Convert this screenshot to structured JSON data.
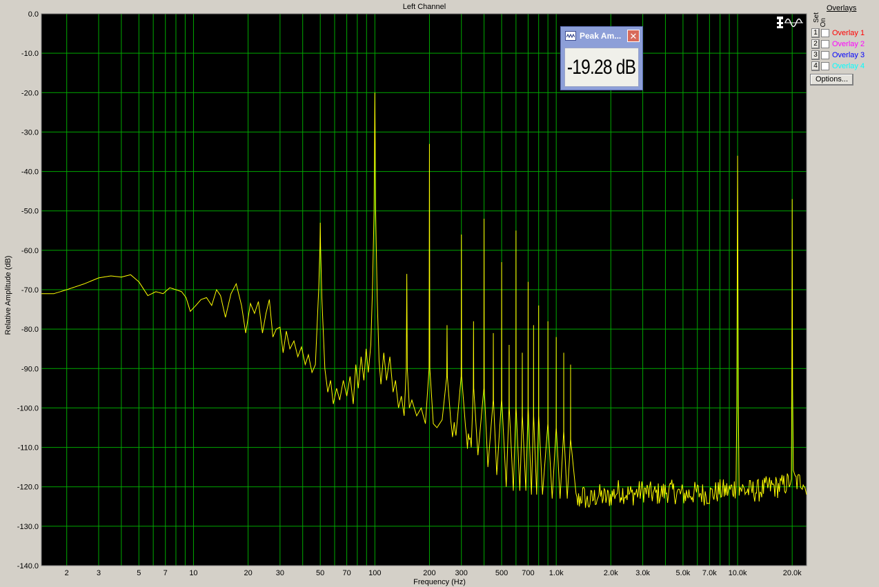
{
  "chart_data": {
    "type": "line",
    "title": "Left Channel",
    "xlabel": "Frequency (Hz)",
    "ylabel": "Relative Amplitude (dB)",
    "x_scale": "log",
    "xlim": [
      1.45,
      24000
    ],
    "ylim": [
      -140,
      0
    ],
    "grid": true,
    "y_ticks": [
      "0.0",
      "-10.0",
      "-20.0",
      "-30.0",
      "-40.0",
      "-50.0",
      "-60.0",
      "-70.0",
      "-80.0",
      "-90.0",
      "-100.0",
      "-110.0",
      "-120.0",
      "-130.0",
      "-140.0"
    ],
    "x_ticks": [
      {
        "value": 2,
        "label": "2"
      },
      {
        "value": 3,
        "label": "3"
      },
      {
        "value": 5,
        "label": "5"
      },
      {
        "value": 7,
        "label": "7"
      },
      {
        "value": 10,
        "label": "10"
      },
      {
        "value": 20,
        "label": "20"
      },
      {
        "value": 30,
        "label": "30"
      },
      {
        "value": 50,
        "label": "50"
      },
      {
        "value": 70,
        "label": "70"
      },
      {
        "value": 100,
        "label": "100"
      },
      {
        "value": 200,
        "label": "200"
      },
      {
        "value": 300,
        "label": "300"
      },
      {
        "value": 500,
        "label": "500"
      },
      {
        "value": 700,
        "label": "700"
      },
      {
        "value": 1000,
        "label": "1.0k"
      },
      {
        "value": 2000,
        "label": "2.0k"
      },
      {
        "value": 3000,
        "label": "3.0k"
      },
      {
        "value": 5000,
        "label": "5.0k"
      },
      {
        "value": 7000,
        "label": "7.0k"
      },
      {
        "value": 10000,
        "label": "10.0k"
      },
      {
        "value": 20000,
        "label": "20.0k"
      }
    ],
    "series": [
      {
        "color": "#ffff00",
        "baseline": [
          [
            1.45,
            -71
          ],
          [
            1.7,
            -71
          ],
          [
            2,
            -70
          ],
          [
            2.5,
            -68.5
          ],
          [
            3,
            -67
          ],
          [
            3.5,
            -66.5
          ],
          [
            4,
            -66.8
          ],
          [
            4.5,
            -66.2
          ],
          [
            5,
            -68
          ],
          [
            5.6,
            -71.5
          ],
          [
            6.2,
            -70.5
          ],
          [
            6.8,
            -71
          ],
          [
            7.4,
            -69.5
          ],
          [
            8,
            -70
          ],
          [
            8.6,
            -70.5
          ],
          [
            9.1,
            -72
          ],
          [
            9.6,
            -75.5
          ],
          [
            10.3,
            -74
          ],
          [
            11,
            -72.5
          ],
          [
            11.8,
            -72
          ],
          [
            12.6,
            -74
          ],
          [
            13.4,
            -70
          ],
          [
            14.1,
            -71.5
          ],
          [
            15,
            -77
          ],
          [
            16.1,
            -71
          ],
          [
            17.2,
            -68.5
          ],
          [
            18.4,
            -74
          ],
          [
            19.4,
            -81
          ],
          [
            20.6,
            -73.5
          ],
          [
            21.7,
            -76
          ],
          [
            22.8,
            -73
          ],
          [
            24,
            -81
          ],
          [
            25.1,
            -76
          ],
          [
            26.2,
            -72.5
          ],
          [
            27.4,
            -82
          ],
          [
            28.6,
            -80
          ],
          [
            30,
            -79.5
          ],
          [
            31.2,
            -86
          ],
          [
            32.5,
            -80.5
          ],
          [
            34,
            -85
          ],
          [
            35.8,
            -83
          ],
          [
            37.6,
            -87
          ],
          [
            39.4,
            -84.5
          ],
          [
            41.3,
            -89
          ],
          [
            43,
            -86.5
          ],
          [
            45,
            -91
          ],
          [
            47,
            -89
          ],
          [
            49,
            -70
          ],
          [
            49.8,
            -59
          ],
          [
            50,
            -53
          ],
          [
            50.2,
            -59
          ],
          [
            51,
            -72
          ],
          [
            53,
            -90
          ],
          [
            55,
            -96
          ],
          [
            57,
            -93
          ],
          [
            59,
            -99
          ],
          [
            61.5,
            -95
          ],
          [
            64,
            -98
          ],
          [
            67,
            -93
          ],
          [
            70,
            -97
          ],
          [
            73,
            -92
          ],
          [
            76,
            -99
          ],
          [
            78.5,
            -89
          ],
          [
            81,
            -95
          ],
          [
            84,
            -87
          ],
          [
            87,
            -93
          ],
          [
            89.5,
            -85
          ],
          [
            92,
            -91
          ],
          [
            95,
            -84
          ],
          [
            97,
            -70
          ],
          [
            99,
            -50
          ],
          [
            100,
            -20
          ],
          [
            101,
            -50
          ],
          [
            103,
            -72
          ],
          [
            105.5,
            -88
          ],
          [
            108,
            -94
          ],
          [
            112,
            -86
          ],
          [
            116,
            -93
          ],
          [
            121,
            -87
          ],
          [
            126,
            -96
          ],
          [
            130,
            -93
          ],
          [
            135,
            -100
          ],
          [
            140,
            -97
          ],
          [
            145,
            -102
          ],
          [
            149,
            -90
          ],
          [
            150,
            -66
          ],
          [
            151,
            -90
          ],
          [
            155,
            -100
          ],
          [
            160,
            -98
          ],
          [
            170,
            -102
          ],
          [
            180,
            -100
          ],
          [
            190,
            -104
          ],
          [
            199,
            -90
          ],
          [
            200,
            -33
          ],
          [
            201,
            -90
          ],
          [
            210,
            -104
          ],
          [
            220,
            -105
          ],
          [
            235,
            -103
          ],
          [
            249,
            -92
          ],
          [
            250,
            -79
          ],
          [
            251,
            -92
          ],
          [
            265,
            -106
          ],
          [
            280,
            -107
          ],
          [
            299,
            -92
          ],
          [
            300,
            -56
          ],
          [
            301,
            -92
          ],
          [
            320,
            -108
          ],
          [
            340,
            -110
          ],
          [
            349,
            -95
          ],
          [
            350,
            -78
          ],
          [
            351,
            -95
          ],
          [
            370,
            -112
          ],
          [
            399,
            -95
          ],
          [
            400,
            -52
          ],
          [
            401,
            -95
          ],
          [
            420,
            -115
          ],
          [
            449,
            -98
          ],
          [
            450,
            -81
          ],
          [
            451,
            -98
          ],
          [
            470,
            -117
          ],
          [
            499,
            -98
          ],
          [
            500,
            -63
          ],
          [
            501,
            -98
          ],
          [
            530,
            -120
          ],
          [
            549,
            -100
          ],
          [
            550,
            -84
          ],
          [
            551,
            -100
          ],
          [
            580,
            -121
          ],
          [
            599,
            -100
          ],
          [
            600,
            -55
          ],
          [
            601,
            -100
          ],
          [
            630,
            -121
          ],
          [
            649,
            -102
          ],
          [
            650,
            -86
          ],
          [
            651,
            -102
          ],
          [
            680,
            -121
          ],
          [
            699,
            -100
          ],
          [
            700,
            -68
          ],
          [
            701,
            -100
          ],
          [
            730,
            -122
          ],
          [
            749,
            -102
          ],
          [
            750,
            -79
          ],
          [
            751,
            -102
          ],
          [
            780,
            -122
          ],
          [
            799,
            -102
          ],
          [
            800,
            -74
          ],
          [
            801,
            -102
          ],
          [
            840,
            -122
          ],
          [
            899,
            -104
          ],
          [
            900,
            -78
          ],
          [
            901,
            -104
          ],
          [
            950,
            -123
          ],
          [
            999,
            -105
          ],
          [
            1000,
            -82
          ],
          [
            1001,
            -105
          ],
          [
            1050,
            -123
          ],
          [
            1099,
            -106
          ],
          [
            1100,
            -86
          ],
          [
            1101,
            -106
          ],
          [
            1150,
            -123
          ],
          [
            1199,
            -108
          ],
          [
            1200,
            -89
          ],
          [
            1201,
            -108
          ],
          [
            1300,
            -124
          ],
          [
            1400,
            -122
          ],
          [
            1500,
            -124
          ],
          [
            1700,
            -122
          ],
          [
            1900,
            -123
          ],
          [
            2200,
            -121
          ],
          [
            2600,
            -122
          ],
          [
            3000,
            -121
          ],
          [
            3500,
            -122
          ],
          [
            4200,
            -121
          ],
          [
            5000,
            -122
          ],
          [
            6000,
            -121.5
          ],
          [
            7000,
            -122
          ],
          [
            8000,
            -121
          ],
          [
            9000,
            -121
          ],
          [
            9800,
            -120
          ],
          [
            9900,
            -100
          ],
          [
            10000,
            -36
          ],
          [
            10100,
            -100
          ],
          [
            10200,
            -120
          ],
          [
            11000,
            -121
          ],
          [
            13000,
            -121
          ],
          [
            15000,
            -120
          ],
          [
            17000,
            -120
          ],
          [
            19000,
            -119
          ],
          [
            19800,
            -118
          ],
          [
            19900,
            -95
          ],
          [
            20000,
            -47
          ],
          [
            20100,
            -95
          ],
          [
            20300,
            -118
          ],
          [
            21500,
            -119
          ],
          [
            23000,
            -118
          ],
          [
            24000,
            -122
          ]
        ]
      }
    ]
  },
  "peak_window": {
    "title": "Peak Am...",
    "value": "-19.28 dB"
  },
  "overlays_panel": {
    "header": "Overlays",
    "set_label": "Set",
    "on_label": "On",
    "items": [
      {
        "num": "1",
        "label": "Overlay 1",
        "color": "#ff0000"
      },
      {
        "num": "2",
        "label": "Overlay 2",
        "color": "#ff00ff"
      },
      {
        "num": "3",
        "label": "Overlay 3",
        "color": "#0000ff"
      },
      {
        "num": "4",
        "label": "Overlay 4",
        "color": "#00ffff"
      }
    ],
    "options_label": "Options..."
  },
  "icons": {
    "mode": "spectrum-sine-icon",
    "peak_app": "waveform-icon",
    "close": "close-icon"
  }
}
